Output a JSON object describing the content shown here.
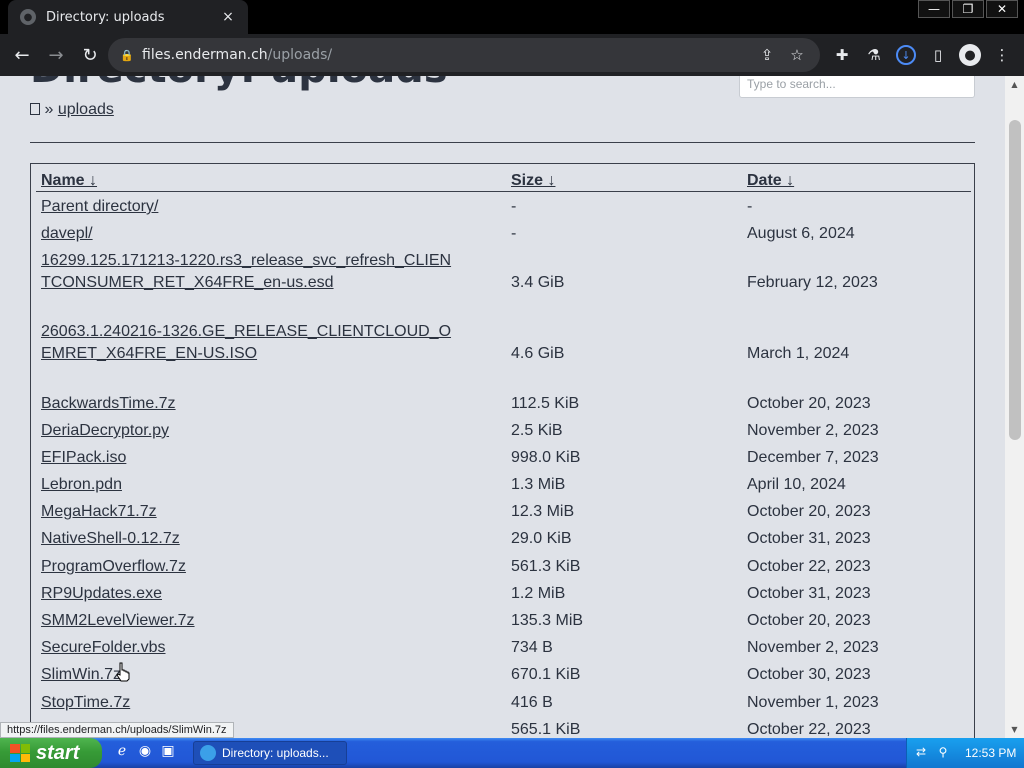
{
  "browser": {
    "tab_title": "Directory: uploads",
    "tab_close": "×",
    "url_host": "files.enderman.ch",
    "url_path": "/uploads/",
    "window_minimize": "—",
    "window_restore": "❐",
    "window_close": "✕"
  },
  "page": {
    "title": "Directory: uploads",
    "search_placeholder": "Type to search...",
    "breadcrumb_sep": "»",
    "breadcrumb_current": "uploads",
    "columns": {
      "name": "Name ↓",
      "size": "Size ↓",
      "date": "Date ↓"
    },
    "rows": [
      {
        "name": "Parent directory/",
        "size": "-",
        "date": "-"
      },
      {
        "name": "davepl/",
        "size": "-",
        "date": "August 6, 2024"
      },
      {
        "name": "16299.125.171213-1220.rs3_release_svc_refresh_CLIENTCONSUMER_RET_X64FRE_en-us.esd",
        "size": "3.4 GiB",
        "date": "February 12, 2023"
      },
      {
        "name": "26063.1.240216-1326.GE_RELEASE_CLIENTCLOUD_OEMRET_X64FRE_EN-US.ISO",
        "size": "4.6 GiB",
        "date": "March 1, 2024"
      },
      {
        "name": "BackwardsTime.7z",
        "size": "112.5 KiB",
        "date": "October 20, 2023"
      },
      {
        "name": "DeriaDecryptor.py",
        "size": "2.5 KiB",
        "date": "November 2, 2023"
      },
      {
        "name": "EFIPack.iso",
        "size": "998.0 KiB",
        "date": "December 7, 2023"
      },
      {
        "name": "Lebron.pdn",
        "size": "1.3 MiB",
        "date": "April 10, 2024"
      },
      {
        "name": "MegaHack71.7z",
        "size": "12.3 MiB",
        "date": "October 20, 2023"
      },
      {
        "name": "NativeShell-0.12.7z",
        "size": "29.0 KiB",
        "date": "October 31, 2023"
      },
      {
        "name": "ProgramOverflow.7z",
        "size": "561.3 KiB",
        "date": "October 22, 2023"
      },
      {
        "name": "RP9Updates.exe",
        "size": "1.2 MiB",
        "date": "October 31, 2023"
      },
      {
        "name": "SMM2LevelViewer.7z",
        "size": "135.3 MiB",
        "date": "October 20, 2023"
      },
      {
        "name": "SecureFolder.vbs",
        "size": "734 B",
        "date": "November 2, 2023"
      },
      {
        "name": "SlimWin.7z",
        "size": "670.1 KiB",
        "date": "October 30, 2023"
      },
      {
        "name": "StopTime.7z",
        "size": "416 B",
        "date": "November 1, 2023"
      },
      {
        "name": "",
        "size": "565.1 KiB",
        "date": "October 22, 2023"
      }
    ],
    "status_url": "https://files.enderman.ch/uploads/SlimWin.7z"
  },
  "taskbar": {
    "start_label": "start",
    "task_label": "Directory: uploads...",
    "clock": "12:53 PM"
  }
}
